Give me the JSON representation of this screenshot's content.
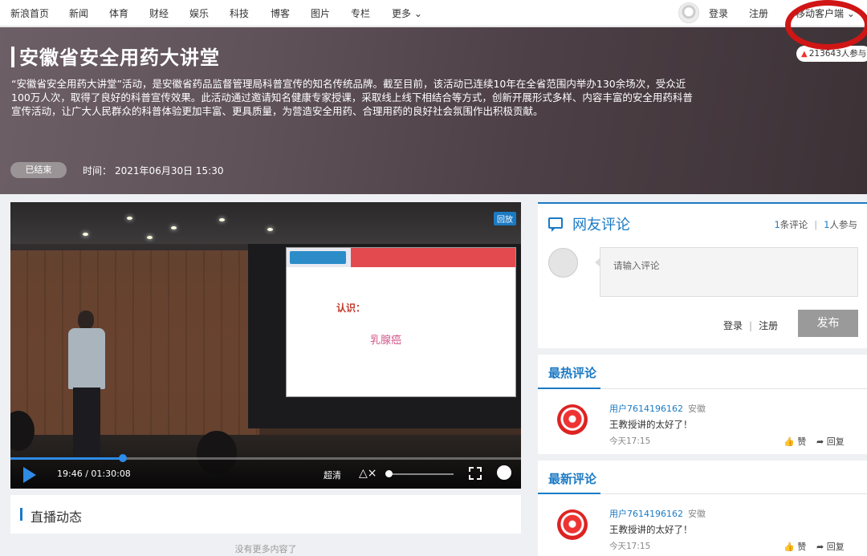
{
  "nav": {
    "items": [
      "新浪首页",
      "新闻",
      "体育",
      "财经",
      "娱乐",
      "科技",
      "博客",
      "图片",
      "专栏",
      "更多 ⌄"
    ],
    "login": "登录",
    "register": "注册",
    "mobile": "移动客户端 ⌄"
  },
  "hero": {
    "title": "安徽省安全用药大讲堂",
    "description": "“安徽省安全用药大讲堂”活动，是安徽省药品监督管理局科普宣传的知名传统品牌。截至目前，该活动已连续10年在全省范围内举办130余场次，受众近100万人次，取得了良好的科普宣传效果。此活动通过邀请知名健康专家授课，采取线上线下相结合等方式，创新开展形式多样、内容丰富的安全用药科普宣传活动，让广大人民群众的科普体验更加丰富、更具质量，为营造安全用药、合理用药的良好社会氛围作出积极贡献。",
    "status": "已结束",
    "time_label": "时间：",
    "time_value": "2021年06月30日 15:30",
    "participants": "213643人参与"
  },
  "video": {
    "replay_tag": "回放",
    "slide_line1": "认识：",
    "slide_line2": "乳腺癌",
    "current_time": "19:46",
    "duration": "01:30:08",
    "time_separator": " / ",
    "quality": "超清",
    "progress": 0.22,
    "volume": 0.0
  },
  "live": {
    "title": "直播动态",
    "empty": "没有更多内容了"
  },
  "comments": {
    "title": "网友评论",
    "comment_count": "1",
    "comment_count_label": "条评论",
    "participant_count": "1",
    "participant_label": "人参与",
    "input_placeholder": "请输入评论",
    "login": "登录",
    "register": "注册",
    "publish": "发布",
    "hot_title": "最热评论",
    "new_title": "最新评论",
    "hot": [
      {
        "user": "用户7614196162",
        "location": "安徽",
        "text": "王教授讲的太好了！",
        "time": "今天17:15",
        "like": "赞",
        "reply": "回复"
      }
    ],
    "new": [
      {
        "user": "用户7614196162",
        "location": "安徽",
        "text": "王教授讲的太好了！",
        "time": "今天17:15",
        "like": "赞",
        "reply": "回复"
      }
    ]
  },
  "colors": {
    "accent": "#1b7ac4",
    "annotation": "#d01515"
  },
  "icons": [
    "avatar-icon",
    "fire-icon",
    "play-icon",
    "mute-icon",
    "fullscreen-icon",
    "share-icon",
    "comment-icon",
    "like-icon",
    "reply-icon"
  ]
}
